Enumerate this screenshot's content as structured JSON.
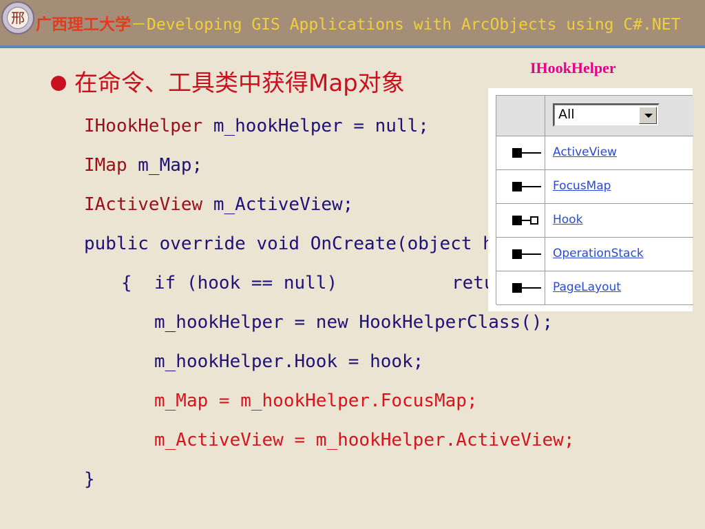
{
  "header": {
    "logo_glyph": "邢",
    "title_cn": "广西理工大学",
    "title_sep": "－",
    "title_en": "Developing GIS Applications with ArcObjects using C#.NET"
  },
  "content": {
    "bullet": "在命令、工具类中获得Map对象",
    "code": {
      "l1_type": "IHookHelper ",
      "l1_rest": "m_hookHelper = null;",
      "l2_type": "IMap ",
      "l2_rest": "m_Map;",
      "l3_type": "IActiveView ",
      "l3_rest": "m_ActiveView;",
      "l4": "public override void OnCreate(object hook)",
      "l5_brace": "{",
      "l5_if": "if (hook == null)",
      "l5_ret": "return;",
      "l6": "m_hookHelper = new HookHelperClass();",
      "l7": "m_hookHelper.Hook = hook;",
      "l8": "m_Map = m_hookHelper.FocusMap;",
      "l9": "m_ActiveView = m_hookHelper.ActiveView;",
      "l10": "}"
    }
  },
  "panel": {
    "label": "IHookHelper",
    "filter_value": "All",
    "properties": [
      {
        "name": "ActiveView",
        "icon": "read-only-property-icon"
      },
      {
        "name": "FocusMap",
        "icon": "read-only-property-icon"
      },
      {
        "name": "Hook",
        "icon": "read-write-property-icon"
      },
      {
        "name": "OperationStack",
        "icon": "read-only-property-icon"
      },
      {
        "name": "PageLayout",
        "icon": "read-only-property-icon"
      }
    ]
  },
  "colors": {
    "background": "#ECE4D3",
    "header_bg": "#A48E78",
    "header_rule": "#5E86B4",
    "code_dark": "#1E1178",
    "code_red": "#D7141E",
    "label_magenta": "#E6008A",
    "link_blue": "#2A49D8"
  }
}
